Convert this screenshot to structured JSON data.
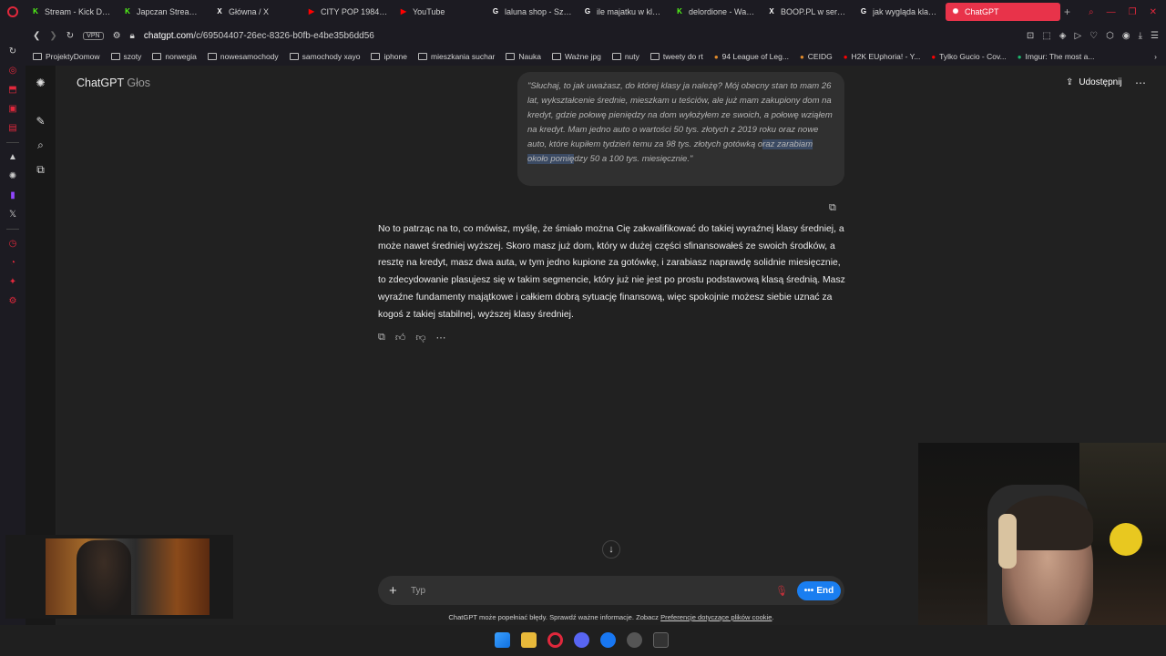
{
  "browser": {
    "tabs": [
      {
        "label": "Stream - Kick Dashboard",
        "icon": "kick-icon",
        "color": "#53fc18"
      },
      {
        "label": "Japczan Stream - Kick",
        "icon": "kick-icon",
        "color": "#53fc18"
      },
      {
        "label": "Główna / X",
        "icon": "x-icon",
        "color": "#ffffff"
      },
      {
        "label": "CITY POP 1984 - YouTube",
        "icon": "youtube-icon",
        "color": "#ff0000"
      },
      {
        "label": "YouTube",
        "icon": "youtube-icon",
        "color": "#ff0000"
      },
      {
        "label": "laluna shop - Szukaj w Google",
        "icon": "google-icon",
        "color": "#ffffff"
      },
      {
        "label": "ile majatku w klasie średniej",
        "icon": "google-icon",
        "color": "#ffffff"
      },
      {
        "label": "delordione - Watch",
        "icon": "kick-icon",
        "color": "#53fc18"
      },
      {
        "label": "BOOP.PL w serwisie X",
        "icon": "x-icon",
        "color": "#ffffff"
      },
      {
        "label": "jak wygląda klasa średnia",
        "icon": "google-icon",
        "color": "#ffffff"
      },
      {
        "label": "ChatGPT",
        "icon": "chatgpt-icon",
        "color": "#ffffff",
        "active": true
      }
    ],
    "new_tab": "+",
    "url_host": "chatgpt.com",
    "url_path": "/c/69504407-26ec-8326-b0fb-e4be35b6dd56",
    "vpn_label": "VPN",
    "bookmarks": [
      {
        "label": "ProjektyDomow",
        "icon": "folder-icon"
      },
      {
        "label": "szoty",
        "icon": "folder-icon"
      },
      {
        "label": "norwegia",
        "icon": "folder-icon"
      },
      {
        "label": "nowesamochody",
        "icon": "folder-icon"
      },
      {
        "label": "samochody xayo",
        "icon": "folder-icon"
      },
      {
        "label": "iphone",
        "icon": "folder-icon"
      },
      {
        "label": "mieszkania suchar",
        "icon": "folder-icon"
      },
      {
        "label": "Nauka",
        "icon": "folder-icon"
      },
      {
        "label": "Ważne jpg",
        "icon": "folder-icon"
      },
      {
        "label": "nuty",
        "icon": "folder-icon"
      },
      {
        "label": "tweety do rt",
        "icon": "folder-icon"
      },
      {
        "label": "94 League of Leg...",
        "icon": "league-icon"
      },
      {
        "label": "CEIDG",
        "icon": "ceidg-icon"
      },
      {
        "label": "H2K EUphoria! - Y...",
        "icon": "youtube-icon"
      },
      {
        "label": "Tylko Gucio - Cov...",
        "icon": "youtube-icon"
      },
      {
        "label": "Imgur: The most a...",
        "icon": "imgur-icon"
      }
    ]
  },
  "chat": {
    "app_name": "ChatGPT",
    "mode_label": "Głos",
    "share_label": "Udostępnij",
    "user_message_pre": "\"Słuchaj, to jak uważasz, do której klasy ja należę? Mój obecny stan to mam 26 lat, wykształcenie średnie, mieszkam u teściów, ale już mam zakupiony dom na kredyt, gdzie połowę pieniędzy na dom wyłożyłem ze swoich, a połowę wziąłem na kredyt. Mam jedno auto o wartości 50 tys. złotych z 2019 roku oraz nowe auto, które kupiłem tydzień temu za 98 tys. złotych gotówką o",
    "user_message_highlight": "raz zarabiam około pomię",
    "user_message_post": "dzy 50 a 100 tys. miesięcznie.\"",
    "assistant_message": "No to patrząc na to, co mówisz, myślę, że śmiało można Cię zakwalifikować do takiej wyraźnej klasy średniej, a może nawet średniej wyższej. Skoro masz już dom, który w dużej części sfinansowałeś ze swoich środków, a resztę na kredyt, masz dwa auta, w tym jedno kupione za gotówkę, i zarabiasz naprawdę solidnie miesięcznie, to zdecydowanie plasujesz się w takim segmencie, który już nie jest po prostu podstawową klasą średnią. Masz wyraźne fundamenty majątkowe i całkiem dobrą sytuację finansową, więc spokojnie możesz siebie uznać za kogoś z takiej stabilnej, wyższej klasy średniej.",
    "composer_placeholder": "Typ",
    "end_label": "End",
    "disclaimer_text": "ChatGPT może popełniać błędy. Sprawdź ważne informacje. Zobacz ",
    "disclaimer_link": "Preferencje dotyczące plików cookie",
    "disclaimer_end": "."
  },
  "colors": {
    "accent": "#1a7ef0",
    "opera_red": "#e0283c",
    "background": "#212121"
  }
}
